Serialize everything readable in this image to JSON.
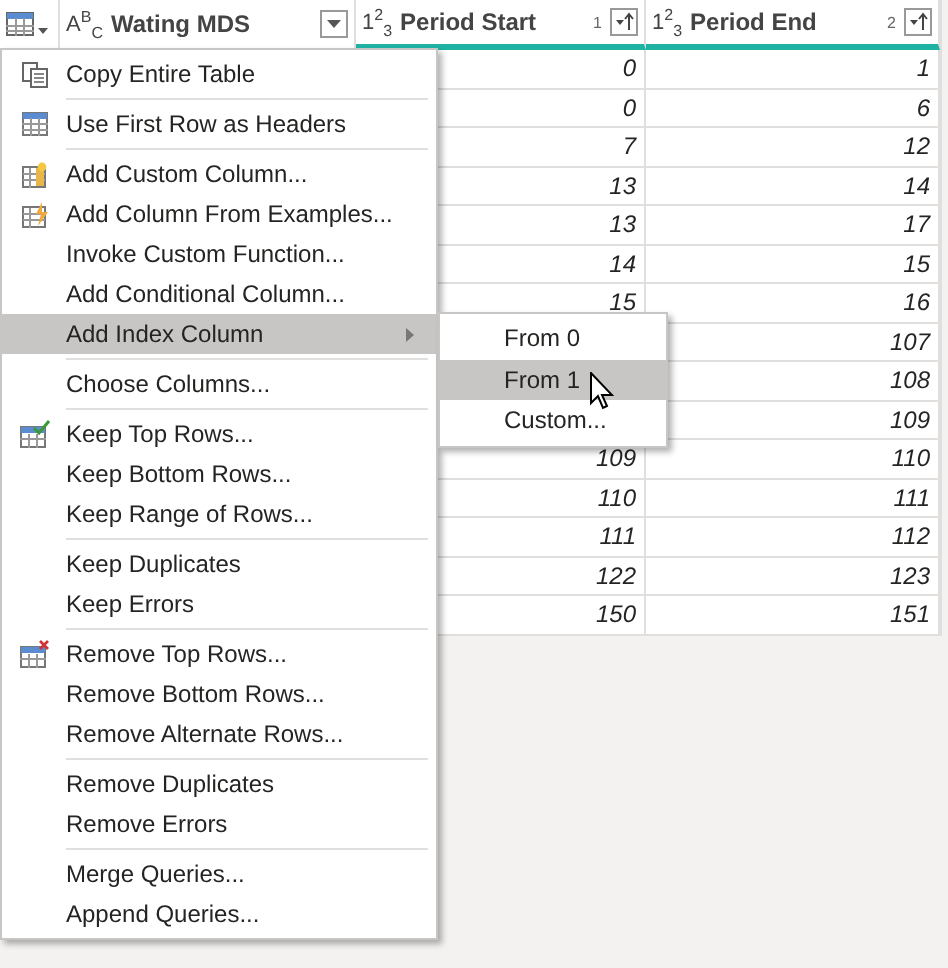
{
  "table": {
    "columns": [
      {
        "type": "A$^{B}$$_{C}$",
        "name": "Wating MDS",
        "teal": false
      },
      {
        "type": "1$^{2}$$_{3}$",
        "name": "Period Start",
        "sort_order": "1",
        "teal": true
      },
      {
        "type": "1$^{2}$$_{3}$",
        "name": "Period End",
        "sort_order": "2",
        "teal": true
      }
    ],
    "rows": [
      {
        "period_start": "0",
        "period_end": "1"
      },
      {
        "period_start": "0",
        "period_end": "6"
      },
      {
        "period_start": "7",
        "period_end": "12"
      },
      {
        "period_start": "13",
        "period_end": "14"
      },
      {
        "period_start": "13",
        "period_end": "17"
      },
      {
        "period_start": "14",
        "period_end": "15"
      },
      {
        "period_start": "15",
        "period_end": "16"
      },
      {
        "period_end": "107"
      },
      {
        "period_end": "108"
      },
      {
        "period_end": "109"
      },
      {
        "period_start": "109",
        "period_end": "110"
      },
      {
        "period_start": "110",
        "period_end": "111"
      },
      {
        "period_start": "111",
        "period_end": "112"
      },
      {
        "period_start": "122",
        "period_end": "123"
      },
      {
        "period_start": "150",
        "period_end": "151"
      }
    ]
  },
  "context_menu": {
    "groups": [
      [
        {
          "label": "Copy Entire Table",
          "kind": "copy",
          "selected": false
        }
      ],
      [
        {
          "label": "Use First Row as Headers",
          "kind": "table",
          "selected": false
        }
      ],
      [
        {
          "label": "Add Custom Column...",
          "kind": "custom",
          "selected": false
        },
        {
          "label": "Add Column From Examples...",
          "kind": "examples",
          "selected": false
        },
        {
          "label": "Invoke Custom Function...",
          "kind": "plain",
          "selected": false
        },
        {
          "label": "Add Conditional Column...",
          "kind": "plain",
          "selected": false
        },
        {
          "label": "Add Index Column",
          "kind": "submenu",
          "selected": true
        }
      ],
      [
        {
          "label": "Choose Columns...",
          "kind": "plain",
          "selected": false
        }
      ],
      [
        {
          "label": "Keep Top Rows...",
          "kind": "keep",
          "selected": false
        },
        {
          "label": "Keep Bottom Rows...",
          "kind": "plain",
          "selected": false
        },
        {
          "label": "Keep Range of Rows...",
          "kind": "plain",
          "selected": false
        }
      ],
      [
        {
          "label": "Keep Duplicates",
          "kind": "plain",
          "selected": false
        },
        {
          "label": "Keep Errors",
          "kind": "plain",
          "selected": false
        }
      ],
      [
        {
          "label": "Remove Top Rows...",
          "kind": "remove",
          "selected": false
        },
        {
          "label": "Remove Bottom Rows...",
          "kind": "plain",
          "selected": false
        },
        {
          "label": "Remove Alternate Rows...",
          "kind": "plain",
          "selected": false
        }
      ],
      [
        {
          "label": "Remove Duplicates",
          "kind": "plain",
          "selected": false
        },
        {
          "label": "Remove Errors",
          "kind": "plain",
          "selected": false
        }
      ],
      [
        {
          "label": "Merge Queries...",
          "kind": "plain",
          "selected": false
        },
        {
          "label": "Append Queries...",
          "kind": "plain",
          "selected": false
        }
      ]
    ]
  },
  "submenu": {
    "items": [
      {
        "label": "From 0",
        "selected": false
      },
      {
        "label": "From 1",
        "selected": true
      },
      {
        "label": "Custom...",
        "selected": false
      }
    ]
  }
}
